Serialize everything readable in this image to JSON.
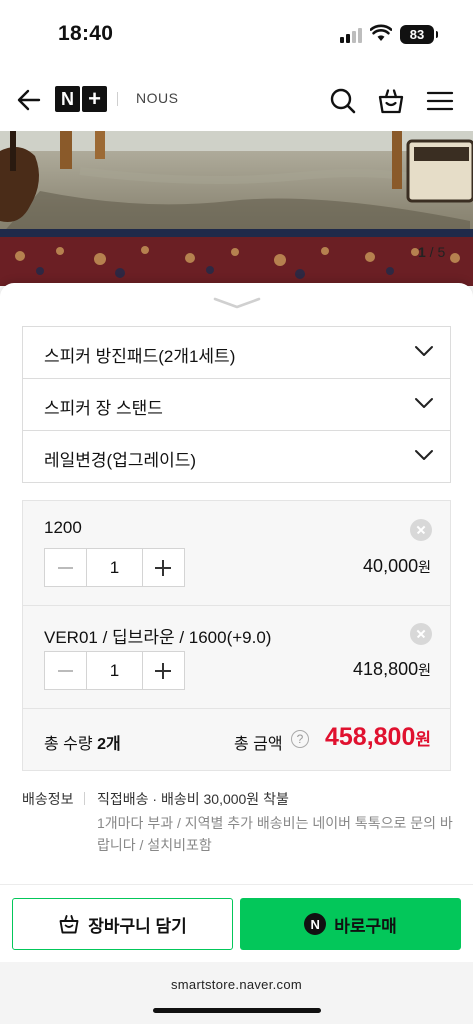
{
  "status_bar": {
    "time": "18:40",
    "battery": "83"
  },
  "header": {
    "store_name": "NOUS",
    "logo_letter": "N",
    "logo_plus": "+"
  },
  "image_counter": {
    "current": "1",
    "separator": " / ",
    "total": "5"
  },
  "options": [
    {
      "label": "스피커 방진패드(2개1세트)"
    },
    {
      "label": "스피커 장 스탠드"
    },
    {
      "label": "레일변경(업그레이드)"
    }
  ],
  "selected_items": [
    {
      "name": "1200",
      "quantity": "1",
      "price": "40,000",
      "currency": "원"
    },
    {
      "name": "VER01 / 딥브라운 / 1600(+9.0)",
      "quantity": "1",
      "price": "418,800",
      "currency": "원"
    }
  ],
  "total": {
    "quantity_label": "총 수량",
    "quantity_value": "2개",
    "amount_label": "총 금액",
    "help": "?",
    "amount": "458,800",
    "currency": "원"
  },
  "shipping": {
    "label": "배송정보",
    "main": "직접배송 · 배송비 30,000원 착불",
    "note": "1개마다 부과 / 지역별 추가 배송비는 네이버 톡톡으로 문의 바랍니다 / 설치비포함"
  },
  "actions": {
    "cart_label": "장바구니 담기",
    "buy_label": "바로구매",
    "buy_badge": "N"
  },
  "browser": {
    "url": "smartstore.naver.com"
  },
  "colors": {
    "accent_green": "#03c75a",
    "price_red": "#e0112f"
  }
}
